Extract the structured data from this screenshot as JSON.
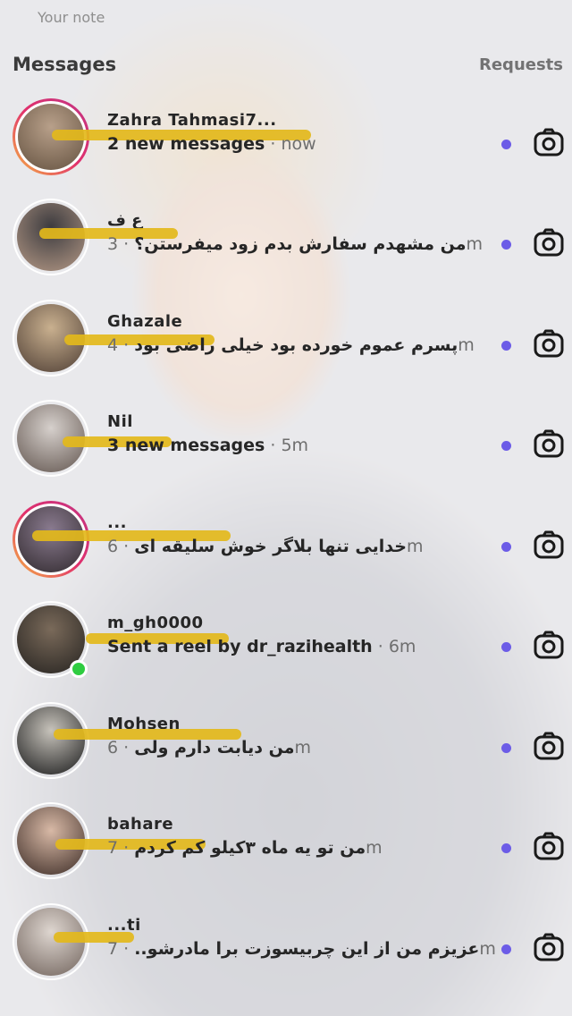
{
  "note_label": "Your note",
  "header": {
    "title": "Messages",
    "requests": "Requests"
  },
  "colors": {
    "unread_dot": "#6c5ce7",
    "scribble": "#e3b91b",
    "online": "#2ecc40"
  },
  "threads": [
    {
      "name": "Zahra Tahmasi7...",
      "message": "2 new messages",
      "time": "now",
      "sep": " · ",
      "story": true,
      "online": false
    },
    {
      "name": "ع ف",
      "message": "من مشهدم سفارش بدم زود میفرستن؟",
      "time": "3m",
      "sep": " · ",
      "story": false,
      "online": false
    },
    {
      "name": "Ghazale",
      "message": "پسرم عموم خورده بود خیلی راضی بود",
      "time": "4m",
      "sep": " · ",
      "story": false,
      "online": false
    },
    {
      "name": "Nil",
      "message": "3 new messages",
      "time": "5m",
      "sep": " · ",
      "story": false,
      "online": false
    },
    {
      "name": "...",
      "message": "خدایی تنها بلاگر خوش سلیقه ای",
      "time": "6m",
      "sep": " · ",
      "story": true,
      "online": false
    },
    {
      "name": "m_gh0000",
      "message": "Sent a reel by dr_razihealth",
      "time": "6m",
      "sep": " · ",
      "story": false,
      "online": true
    },
    {
      "name": "Mohsen",
      "message": "من دیابت دارم ولی",
      "time": "6m",
      "sep": " · ",
      "story": false,
      "online": false
    },
    {
      "name": "bahare",
      "message": "من تو یه ماه ۳کیلو کم کردم",
      "time": "7m",
      "sep": " · ",
      "story": false,
      "online": false
    },
    {
      "name": "...ti",
      "message": "عزیزم من از این چربیسوزت برا مادرشو..",
      "time": "7m",
      "sep": " · ",
      "story": false,
      "online": false
    }
  ]
}
